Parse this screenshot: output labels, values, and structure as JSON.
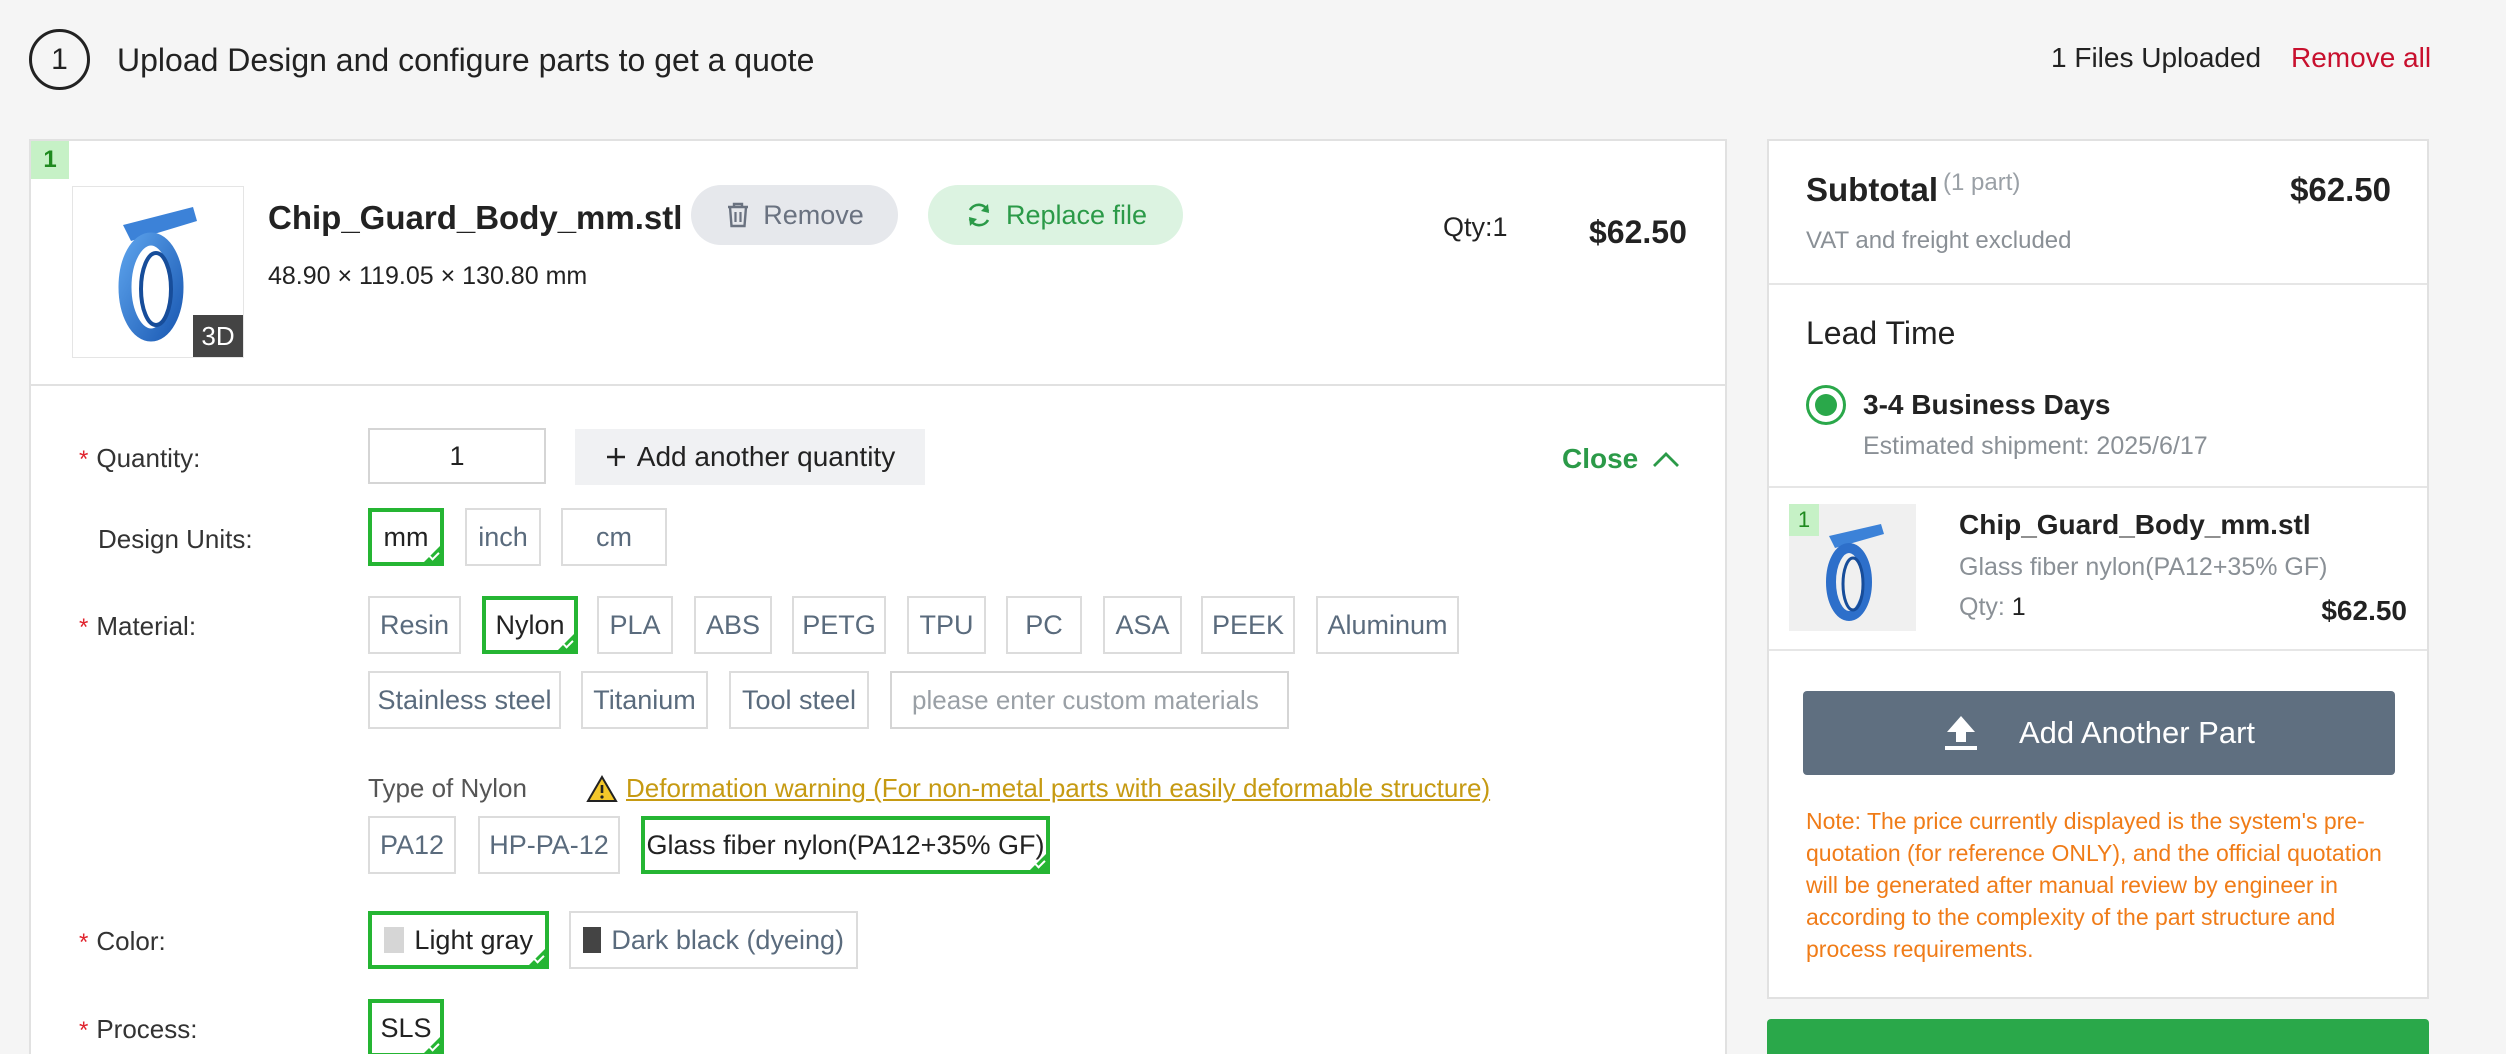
{
  "header": {
    "step_number": "1",
    "title": "Upload Design and configure parts to get a quote",
    "files_uploaded": "1 Files Uploaded",
    "remove_all": "Remove all"
  },
  "part": {
    "index": "1",
    "badge": "3D",
    "filename": "Chip_Guard_Body_mm.stl",
    "dimensions": "48.90 × 119.05 × 130.80 mm",
    "remove_label": "Remove",
    "replace_label": "Replace file",
    "qty_label": "Qty:1",
    "price": "$62.50",
    "thumbnail_icon": "ring-part-thumbnail"
  },
  "form": {
    "quantity": {
      "label": "Quantity:",
      "value": "1",
      "add_another": "Add another quantity"
    },
    "close_label": "Close",
    "design_units": {
      "label": "Design Units:",
      "options": [
        "mm",
        "inch",
        "cm"
      ],
      "selected": "mm"
    },
    "material": {
      "label": "Material:",
      "options": [
        "Resin",
        "Nylon",
        "PLA",
        "ABS",
        "PETG",
        "TPU",
        "PC",
        "ASA",
        "PEEK",
        "Aluminum",
        "Stainless steel",
        "Titanium",
        "Tool steel"
      ],
      "selected": "Nylon",
      "custom_placeholder": "please enter custom materials"
    },
    "type": {
      "label": "Type of Nylon",
      "warning": "Deformation warning (For non-metal parts with easily deformable structure)",
      "options": [
        "PA12",
        "HP-PA-12",
        "Glass fiber nylon(PA12+35% GF)"
      ],
      "selected": "Glass fiber nylon(PA12+35% GF)"
    },
    "color": {
      "label": "Color:",
      "options": [
        "Light gray",
        "Dark black (dyeing)"
      ],
      "swatches": [
        "#d6d6d6",
        "#444444"
      ],
      "selected": "Light gray"
    },
    "process": {
      "label": "Process:",
      "options": [
        "SLS"
      ],
      "selected": "SLS"
    }
  },
  "summary": {
    "title": "Subtotal",
    "parts_count": "(1 part)",
    "price": "$62.50",
    "vat_note": "VAT and freight excluded",
    "lead_time_title": "Lead Time",
    "lead_days": "3-4 Business Days",
    "estimated_shipment": "Estimated shipment: 2025/6/17",
    "item": {
      "index": "1",
      "name": "Chip_Guard_Body_mm.stl",
      "material": "Glass fiber nylon(PA12+35% GF)",
      "qty_label": "Qty:",
      "qty_value": "1",
      "price": "$62.50"
    },
    "add_part_label": "Add Another Part",
    "note": "Note: The price currently displayed is the system's pre-quotation (for reference ONLY), and the official quotation will be generated after manual review by engineer in according to the complexity of the part structure and process requirements."
  },
  "colors": {
    "accent_green": "#25b533",
    "danger_red": "#c8102e",
    "note_orange": "#f07c18",
    "warning_yellow": "#c69a12",
    "button_slate": "#5f6f80"
  }
}
